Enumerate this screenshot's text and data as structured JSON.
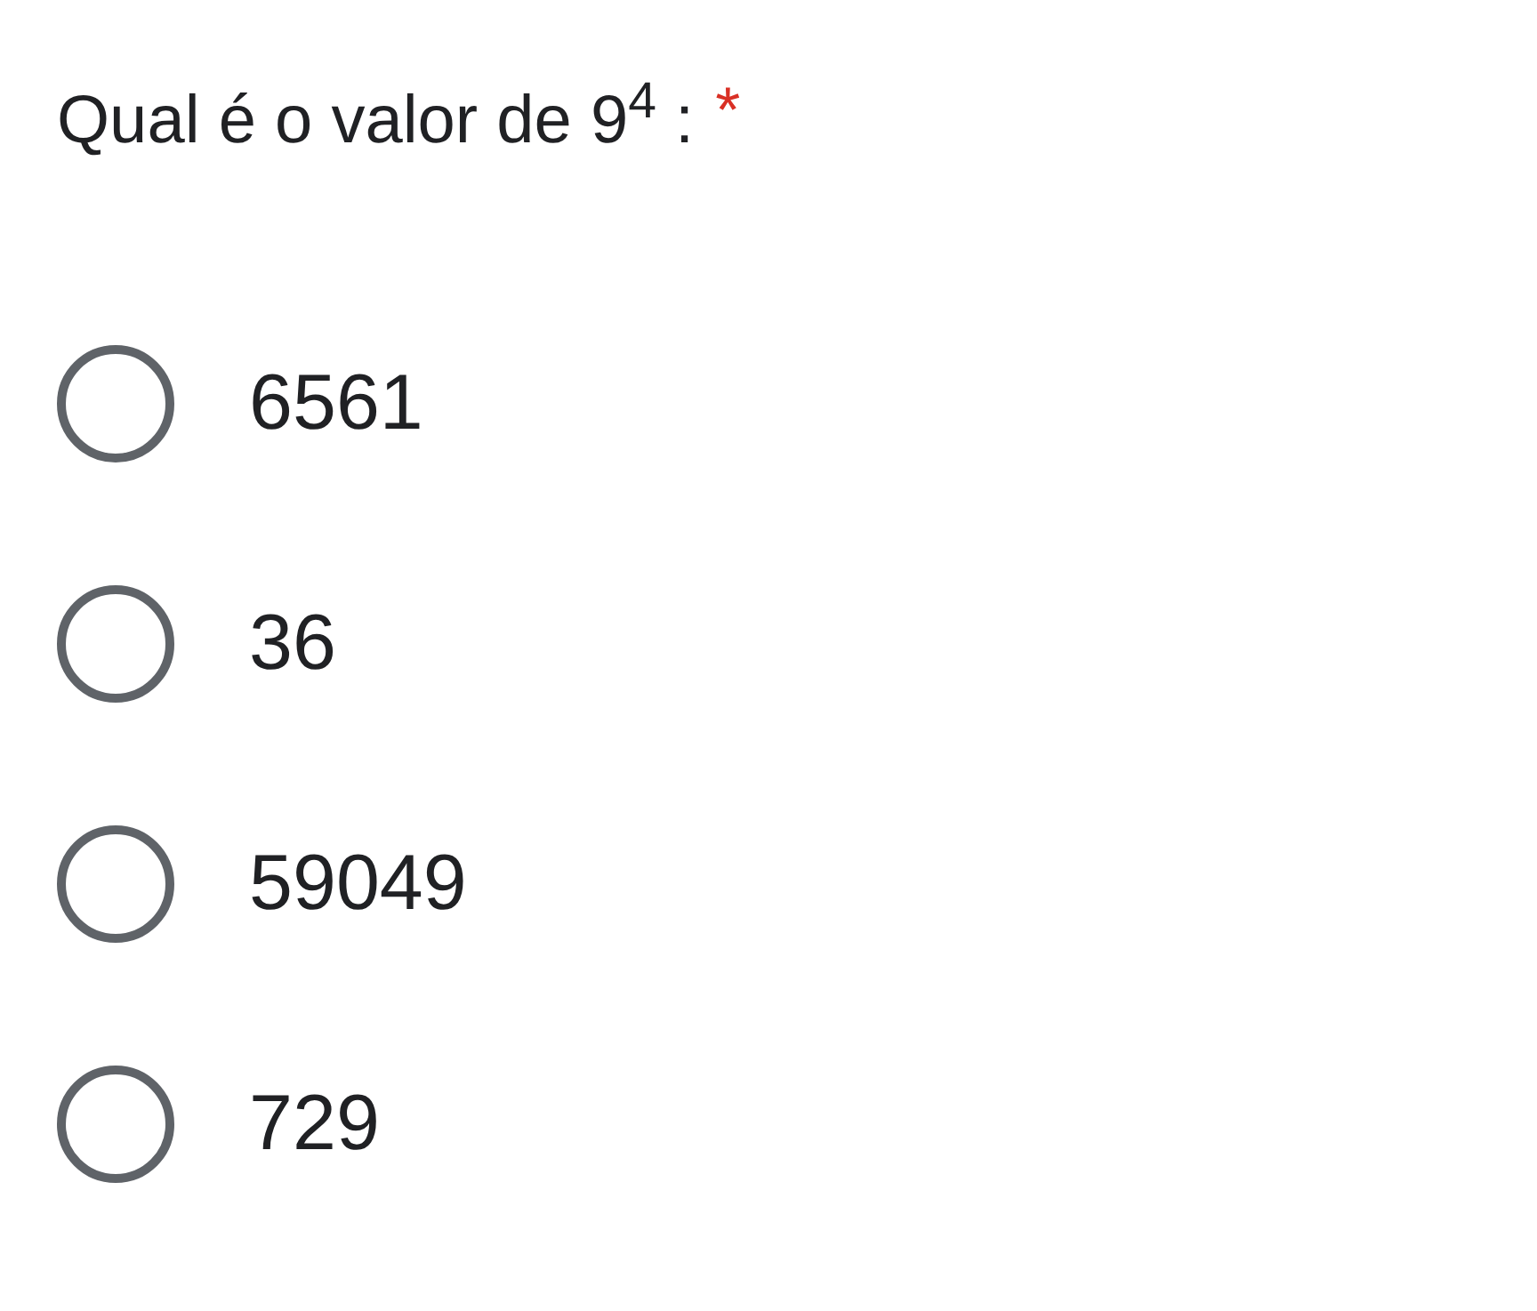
{
  "question": {
    "text": "Qual é o valor de 9$^{4}$ :",
    "required_mark": "*"
  },
  "options": [
    {
      "label": "6561",
      "selected": false
    },
    {
      "label": "36",
      "selected": false
    },
    {
      "label": "59049",
      "selected": false
    },
    {
      "label": "729",
      "selected": false
    }
  ]
}
